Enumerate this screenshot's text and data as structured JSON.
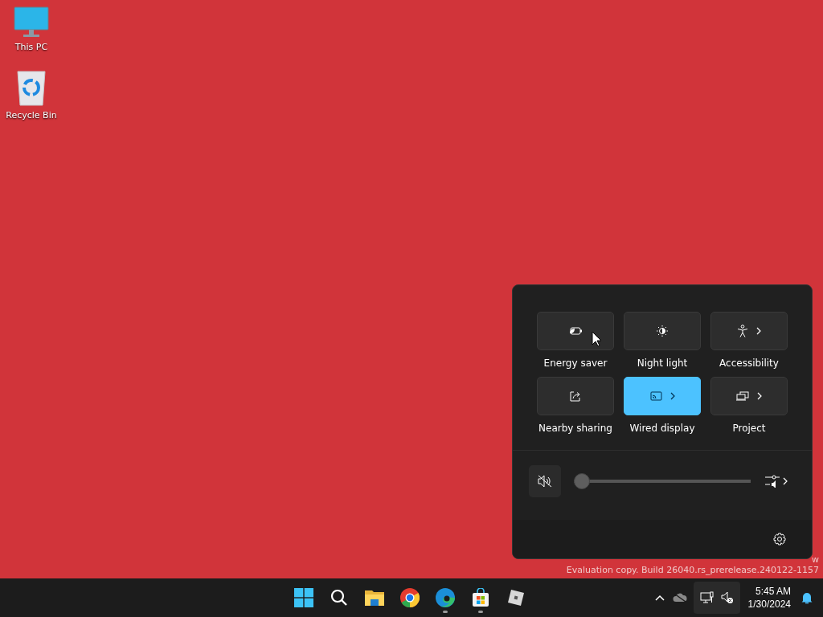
{
  "desktop_icons": [
    {
      "kind": "pc",
      "label": "This PC"
    },
    {
      "kind": "bin",
      "label": "Recycle Bin"
    }
  ],
  "watermark": {
    "line_1": "w",
    "line_2": "Evaluation copy. Build 26040.rs_prerelease.240122-1157"
  },
  "quick_settings": {
    "tiles": [
      {
        "kind": "energy",
        "label": "Energy saver",
        "selected": false,
        "submenu": false
      },
      {
        "kind": "night",
        "label": "Night light",
        "selected": false,
        "submenu": false
      },
      {
        "kind": "accessibility",
        "label": "Accessibility",
        "selected": false,
        "submenu": true
      },
      {
        "kind": "sharing",
        "label": "Nearby sharing",
        "selected": false,
        "submenu": false
      },
      {
        "kind": "cast",
        "label": "Wired display",
        "selected": true,
        "submenu": true
      },
      {
        "kind": "project",
        "label": "Project",
        "selected": false,
        "submenu": true
      }
    ],
    "volume": {
      "muted": true,
      "level": 0
    }
  },
  "taskbar": {
    "apps": [
      {
        "kind": "start",
        "running": false
      },
      {
        "kind": "search",
        "running": false
      },
      {
        "kind": "explorer",
        "running": false
      },
      {
        "kind": "chrome",
        "running": false
      },
      {
        "kind": "edge",
        "running": true
      },
      {
        "kind": "store",
        "running": true
      },
      {
        "kind": "cube",
        "running": false
      }
    ],
    "clock": {
      "time": "5:45 AM",
      "date": "1/30/2024"
    }
  }
}
